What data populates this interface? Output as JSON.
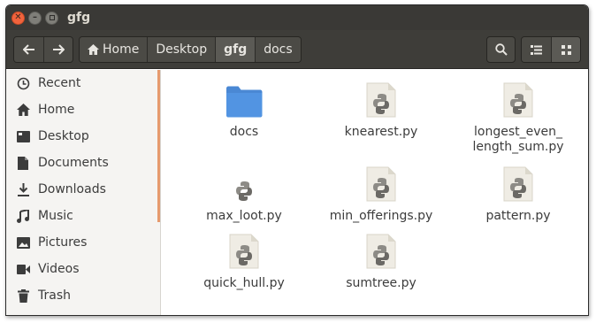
{
  "window": {
    "title": "gfg"
  },
  "toolbar": {
    "back_icon": "arrow-left-icon",
    "forward_icon": "arrow-right-icon",
    "breadcrumbs": [
      {
        "label": "Home",
        "icon": "home-icon"
      },
      {
        "label": "Desktop"
      },
      {
        "label": "gfg",
        "active": true
      },
      {
        "label": "docs"
      }
    ],
    "search_icon": "search-icon",
    "list_view_icon": "list-view-icon",
    "grid_view_icon": "grid-view-icon"
  },
  "sidebar": {
    "items": [
      {
        "label": "Recent",
        "icon": "clock-icon"
      },
      {
        "label": "Home",
        "icon": "home-icon"
      },
      {
        "label": "Desktop",
        "icon": "desktop-icon"
      },
      {
        "label": "Documents",
        "icon": "document-icon"
      },
      {
        "label": "Downloads",
        "icon": "download-icon"
      },
      {
        "label": "Music",
        "icon": "music-icon"
      },
      {
        "label": "Pictures",
        "icon": "picture-icon"
      },
      {
        "label": "Videos",
        "icon": "video-icon"
      },
      {
        "label": "Trash",
        "icon": "trash-icon"
      }
    ]
  },
  "files": [
    {
      "name": "docs",
      "type": "folder"
    },
    {
      "name": "knearest.py",
      "type": "python"
    },
    {
      "name_line1": "longest_even_",
      "name_line2": "length_sum.py",
      "type": "python"
    },
    {
      "name": "max_loot.py",
      "type": "python-small"
    },
    {
      "name": "min_offerings.py",
      "type": "python"
    },
    {
      "name": "pattern.py",
      "type": "python"
    },
    {
      "name": "quick_hull.py",
      "type": "python"
    },
    {
      "name": "sumtree.py",
      "type": "python"
    }
  ],
  "colors": {
    "folder": "#5294e2",
    "titlebar": "#3a3936",
    "sidebar_accent": "#e69a6e",
    "close_button": "#f0633d"
  }
}
